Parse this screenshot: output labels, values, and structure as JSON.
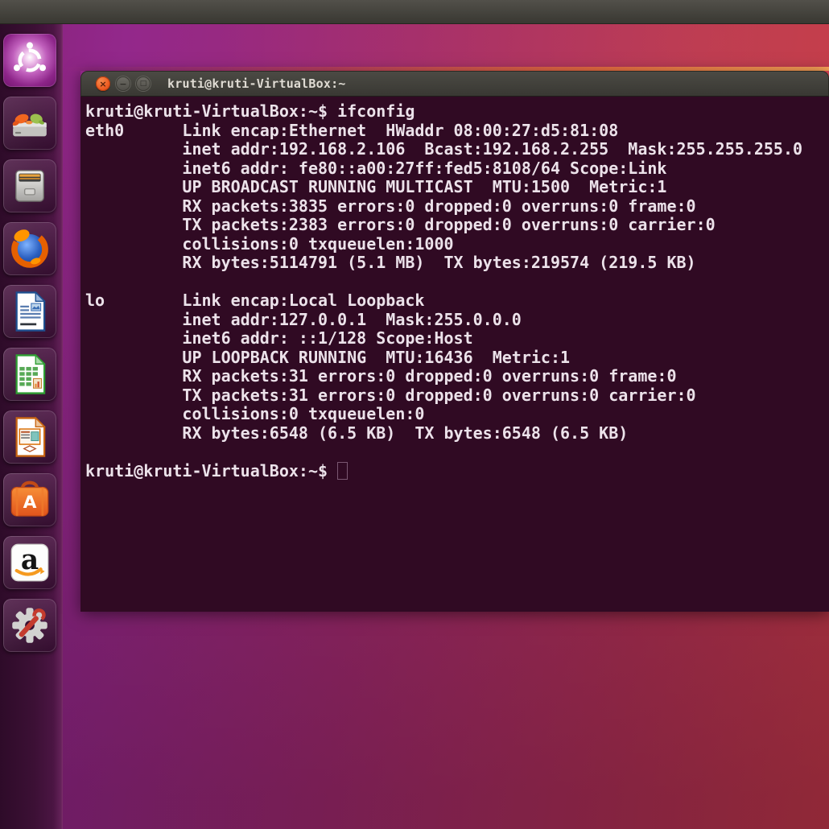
{
  "top_panel": {},
  "launcher": {
    "items": [
      {
        "id": "dash-home"
      },
      {
        "id": "ubuntu-installer"
      },
      {
        "id": "file-manager"
      },
      {
        "id": "firefox"
      },
      {
        "id": "libreoffice-writer"
      },
      {
        "id": "libreoffice-calc"
      },
      {
        "id": "libreoffice-impress"
      },
      {
        "id": "ubuntu-software-center",
        "glyph": "A"
      },
      {
        "id": "amazon",
        "glyph": "a"
      },
      {
        "id": "system-settings"
      }
    ]
  },
  "terminal_window": {
    "title": "kruti@kruti-VirtualBox:~",
    "buttons": {
      "close": "×",
      "minimize": "−",
      "maximize": "□"
    },
    "lines": [
      "kruti@kruti-VirtualBox:~$ ifconfig",
      "eth0      Link encap:Ethernet  HWaddr 08:00:27:d5:81:08",
      "          inet addr:192.168.2.106  Bcast:192.168.2.255  Mask:255.255.255.0",
      "          inet6 addr: fe80::a00:27ff:fed5:8108/64 Scope:Link",
      "          UP BROADCAST RUNNING MULTICAST  MTU:1500  Metric:1",
      "          RX packets:3835 errors:0 dropped:0 overruns:0 frame:0",
      "          TX packets:2383 errors:0 dropped:0 overruns:0 carrier:0",
      "          collisions:0 txqueuelen:1000",
      "          RX bytes:5114791 (5.1 MB)  TX bytes:219574 (219.5 KB)",
      "",
      "lo        Link encap:Local Loopback",
      "          inet addr:127.0.0.1  Mask:255.0.0.0",
      "          inet6 addr: ::1/128 Scope:Host",
      "          UP LOOPBACK RUNNING  MTU:16436  Metric:1",
      "          RX packets:31 errors:0 dropped:0 overruns:0 frame:0",
      "          TX packets:31 errors:0 dropped:0 overruns:0 carrier:0",
      "          collisions:0 txqueuelen:0",
      "          RX bytes:6548 (6.5 KB)  TX bytes:6548 (6.5 KB)",
      "",
      "kruti@kruti-VirtualBox:~$ "
    ]
  },
  "colors": {
    "accent_orange": "#e95420",
    "terminal_background": "#300a23",
    "titlebar": "#3c3b37",
    "launcher_background": "#3c1035",
    "wallpaper_purple": "#93288b",
    "wallpaper_red": "#c43a46"
  }
}
